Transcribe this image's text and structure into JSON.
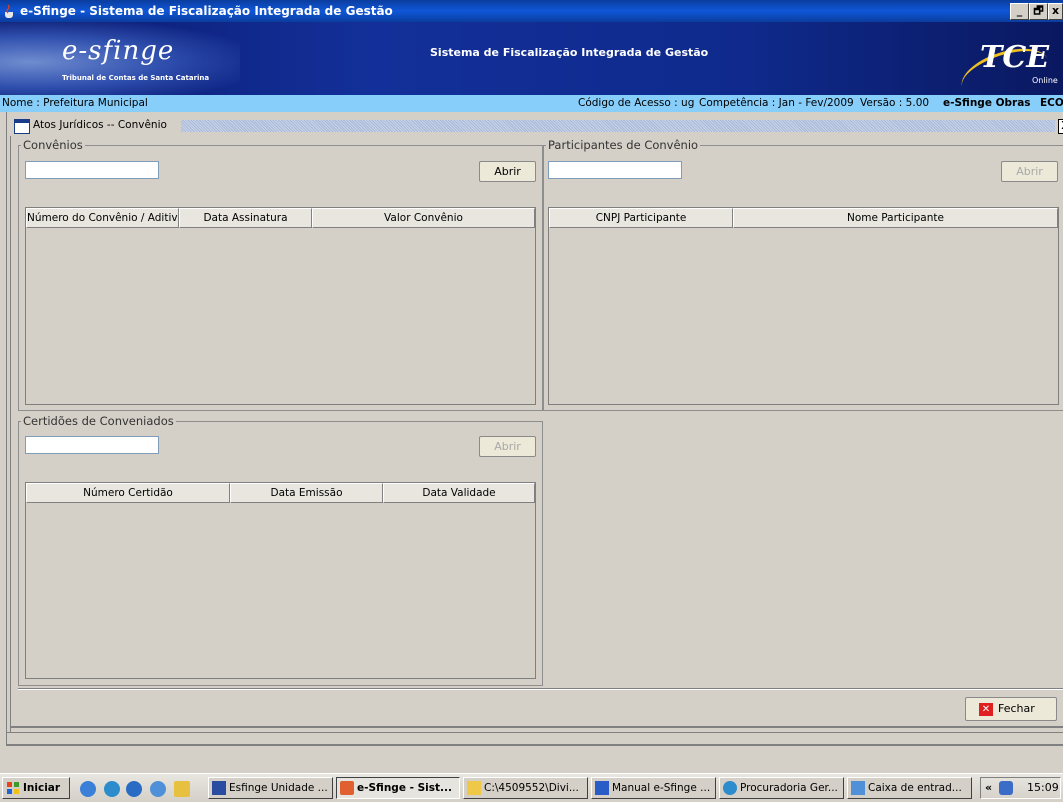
{
  "window": {
    "title": "e-Sfinge - Sistema de Fiscalização Integrada de Gestão",
    "controls": [
      "_",
      "🗗",
      "x"
    ]
  },
  "banner": {
    "logo": "e-sfinge",
    "logo_sub": "Tribunal de Contas de Santa Catarina",
    "center_title": "Sistema de Fiscalização Integrada de Gestão",
    "brand": "TCE",
    "brand_sub": "Online"
  },
  "info": {
    "nome": "Nome : Prefeitura Municipal",
    "codigo": "Código de Acesso : ug",
    "competencia": "Competência : Jan - Fev/2009",
    "versao": "Versão : 5.00",
    "modulo": "e-Sfinge Obras",
    "eco": "ECO"
  },
  "frame": {
    "title": "Atos Jurídicos -- Convênio",
    "close": "X"
  },
  "convenios": {
    "legend": "Convênios",
    "input_value": "",
    "open_label": "Abrir",
    "columns": [
      "Número do Convênio / Aditivo",
      "Data Assinatura",
      "Valor Convênio"
    ]
  },
  "participantes": {
    "legend": "Participantes de Convênio",
    "input_value": "",
    "open_label": "Abrir",
    "columns": [
      "CNPJ Participante",
      "Nome Participante"
    ]
  },
  "certidoes": {
    "legend": "Certidões de Conveniados",
    "input_value": "",
    "open_label": "Abrir",
    "columns": [
      "Número Certidão",
      "Data Emissão",
      "Data Validade"
    ]
  },
  "footer": {
    "close_label": "Fechar"
  },
  "taskbar": {
    "start": "Iniciar",
    "tasks": [
      "Esfinge Unidade ...",
      "e-Sfinge - Sist...",
      "C:\\4509552\\Divi...",
      "Manual e-Sfinge ...",
      "Procuradoria Ger...",
      "Caixa de entrad..."
    ],
    "tray_arrow": "«",
    "clock": "15:09"
  },
  "colors": {
    "titlebar": "#0a3d9e",
    "info_strip": "#87cefa",
    "close_icon": "#e02020"
  }
}
